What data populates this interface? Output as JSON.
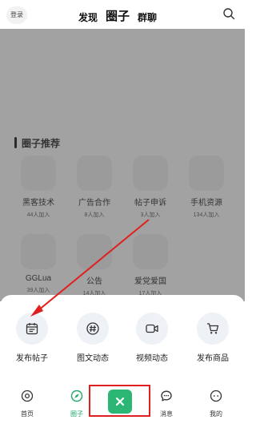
{
  "header": {
    "login_label": "登录",
    "tabs": [
      "发现",
      "圈子",
      "群聊"
    ]
  },
  "section": {
    "title": "圈子推荐"
  },
  "circles": [
    {
      "name": "黑客技术",
      "count": "44人加入"
    },
    {
      "name": "广告合作",
      "count": "8人加入"
    },
    {
      "name": "帖子申诉",
      "count": "3人加入"
    },
    {
      "name": "手机资源",
      "count": "134人加入"
    },
    {
      "name": "GGLua",
      "count": "39人加入"
    },
    {
      "name": "公告",
      "count": "14人加入"
    },
    {
      "name": "爱党爱国",
      "count": "17人加入"
    }
  ],
  "sheet": {
    "actions": [
      {
        "label": "发布帖子",
        "icon": "calendar-icon"
      },
      {
        "label": "图文动态",
        "icon": "hashtag-icon"
      },
      {
        "label": "视频动态",
        "icon": "video-camera-icon"
      },
      {
        "label": "发布商品",
        "icon": "cart-icon"
      }
    ]
  },
  "nav": {
    "items": [
      {
        "label": "首页",
        "icon": "home-icon"
      },
      {
        "label": "圈子",
        "icon": "compass-icon"
      },
      {
        "label": "消息",
        "icon": "message-icon"
      },
      {
        "label": "我的",
        "icon": "profile-icon"
      }
    ]
  },
  "colors": {
    "accent": "#2bb673",
    "highlight": "#e02020",
    "overlay": "rgba(70,70,70,0.5)"
  }
}
